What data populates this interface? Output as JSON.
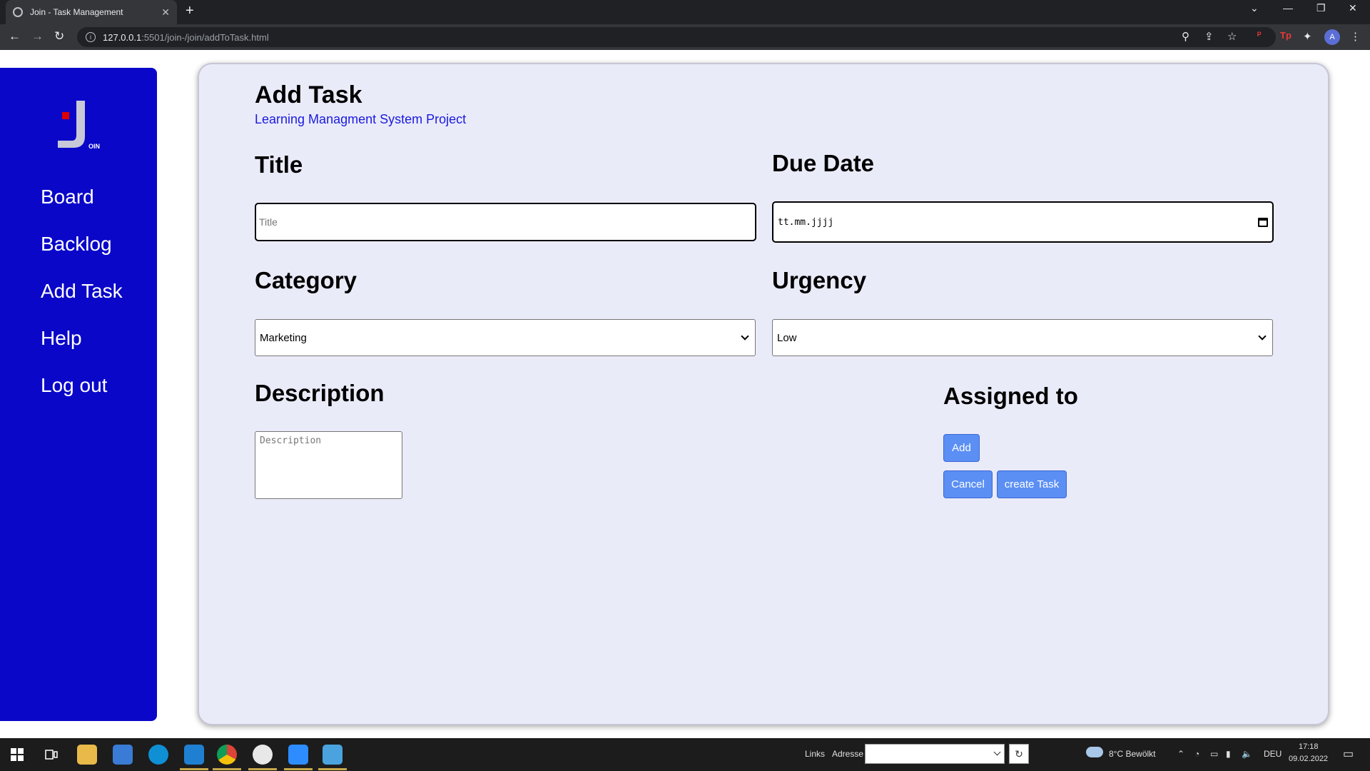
{
  "browser": {
    "tab_title": "Join - Task Management",
    "tab_close": "✕",
    "new_tab": "+",
    "url_host": "127.0.0.1",
    "url_path": ":5501/join-/join/addToTask.html",
    "win_controls": [
      "⌄",
      "—",
      "❐",
      "✕"
    ],
    "nav_icons": {
      "back": "←",
      "forward": "→",
      "reload": "↻"
    },
    "toolbar_icons": {
      "zoom": "⚲",
      "share": "⇪",
      "star": "☆",
      "ext1": "ᴾ",
      "ext2": "Tp",
      "puzzle": "✦",
      "menu": "⋮"
    },
    "profile_initial": "A"
  },
  "sidebar": {
    "logo_letter": "J",
    "logo_text": "OIN",
    "items": [
      {
        "label": "Board"
      },
      {
        "label": "Backlog"
      },
      {
        "label": "Add Task"
      },
      {
        "label": "Help"
      },
      {
        "label": "Log out"
      }
    ]
  },
  "main": {
    "title": "Add Task",
    "subtitle": "Learning Managment System Project",
    "title_label": "Title",
    "title_placeholder": "Title",
    "due_date_label": "Due Date",
    "due_date_value": "tt.mm.jjjj",
    "category_label": "Category",
    "category_value": "Marketing",
    "urgency_label": "Urgency",
    "urgency_value": "Low",
    "description_label": "Description",
    "description_placeholder": "Description",
    "assigned_label": "Assigned to",
    "add_button": "Add",
    "cancel_button": "Cancel",
    "create_button": "create Task"
  },
  "taskbar": {
    "links_label": "Links",
    "address_label": "Adresse",
    "address_go": "↻",
    "weather": "8°C  Bewölkt",
    "language": "DEU",
    "time": "17:18",
    "date": "09.02.2022",
    "system_icons": [
      "⌃",
      "◔",
      "▭",
      "▮",
      "🔈"
    ],
    "notification": "▭"
  },
  "colors": {
    "sidebar": "#0a07c9",
    "card": "#eaebf9",
    "button": "#5b8ff4",
    "subtitle": "#1a1ae0"
  }
}
